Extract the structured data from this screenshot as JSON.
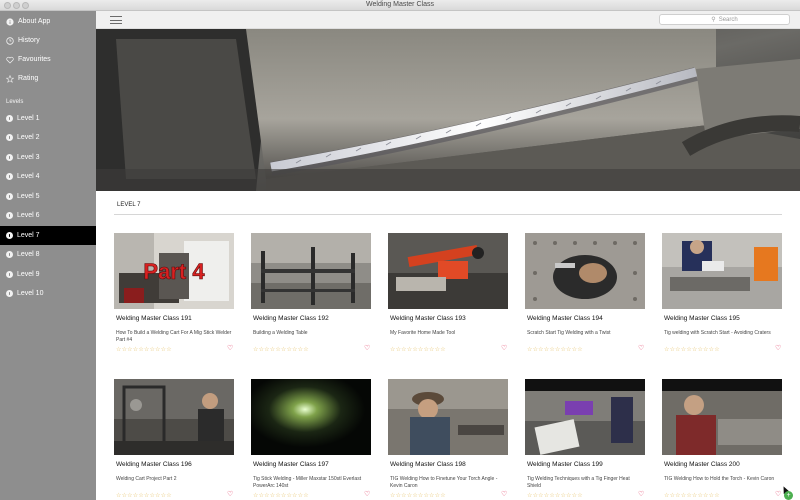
{
  "window": {
    "title": "Welding Master Class"
  },
  "sidebar": {
    "top_items": [
      {
        "label": "About App",
        "icon": "info-circle-icon"
      },
      {
        "label": "History",
        "icon": "clock-icon"
      },
      {
        "label": "Favourites",
        "icon": "heart-outline-icon"
      },
      {
        "label": "Rating",
        "icon": "star-outline-icon"
      }
    ],
    "section_label": "Levels",
    "levels": [
      {
        "label": "Level 1"
      },
      {
        "label": "Level 2"
      },
      {
        "label": "Level 3"
      },
      {
        "label": "Level 4"
      },
      {
        "label": "Level 5"
      },
      {
        "label": "Level 6"
      },
      {
        "label": "Level 7",
        "active": true
      },
      {
        "label": "Level 8"
      },
      {
        "label": "Level 9"
      },
      {
        "label": "Level 10"
      }
    ]
  },
  "toolbar": {
    "search_placeholder": "Search",
    "menu_icon": "hamburger-menu-icon"
  },
  "main": {
    "section_title": "LEVEL 7",
    "rating_stars": "☆☆☆☆☆☆☆☆☆☆",
    "fav_icon": "♡",
    "cards": [
      {
        "title": "Welding Master Class 191",
        "desc": "How To Build a Welding Cart For A Mig  Stick Welder Part #4",
        "thumb_overlay": "Part 4"
      },
      {
        "title": "Welding Master Class 192",
        "desc": "Building a Welding Table"
      },
      {
        "title": "Welding Master Class 193",
        "desc": "My Favorite Home Made Tool"
      },
      {
        "title": "Welding Master Class 194",
        "desc": "Scratch Start Tig Welding with a Twist"
      },
      {
        "title": "Welding Master Class 195",
        "desc": "Tig welding with Scratch Start - Avoiding Craters"
      },
      {
        "title": "Welding Master Class 196",
        "desc": "Welding Cart Project Part 2"
      },
      {
        "title": "Welding Master Class 197",
        "desc": "Tig  Stick Welding - Miller Maxstar 150stl Everlast PowerArc 140st"
      },
      {
        "title": "Welding Master Class 198",
        "desc": "TIG Welding How to Finetune Your Torch Angle - Kevin Caron"
      },
      {
        "title": "Welding Master Class 199",
        "desc": "Tig Welding Techniques with a Tig Finger Heat Shield"
      },
      {
        "title": "Welding Master Class 200",
        "desc": "TIG Welding How to Hold the Torch - Kevin Caron"
      }
    ]
  },
  "colors": {
    "sidebar_bg": "#8e8e8e",
    "active_bg": "#000000",
    "star_color": "#e5c26a",
    "heart_color": "#e0315a"
  }
}
